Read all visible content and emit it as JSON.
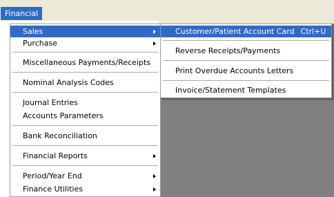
{
  "menubar": {
    "financial_label": "Financial"
  },
  "financial_menu": {
    "sales": "Sales",
    "purchase": "Purchase",
    "misc_payments": "Miscellaneous Payments/Receipts",
    "nominal_codes": "Nominal Analysis Codes",
    "journal_entries": "Journal Entries",
    "accounts_parameters": "Accounts Parameters",
    "bank_reconciliation": "Bank Reconciliation",
    "financial_reports": "Financial Reports",
    "period_year_end": "Period/Year End",
    "finance_utilities": "Finance Utilities"
  },
  "sales_submenu": {
    "account_card": "Customer/Patient Account Card",
    "account_card_shortcut": "Ctrl+U",
    "reverse_receipts": "Reverse Receipts/Payments",
    "overdue_letters": "Print Overdue Accounts Letters",
    "templates": "Invoice/Statement Templates"
  },
  "colors": {
    "highlight": "#316ac5",
    "menubar_bg": "#ece9d8",
    "workspace_bg": "#808080"
  }
}
